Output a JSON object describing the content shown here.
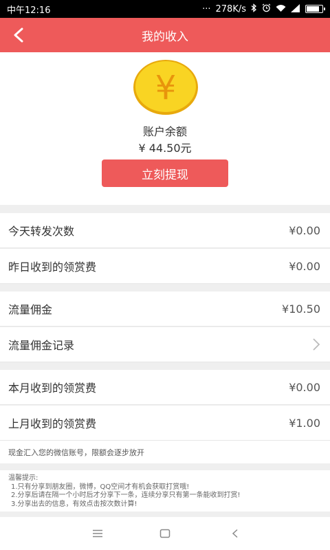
{
  "status_bar": {
    "time": "中午12:16",
    "dots": "···",
    "speed": "278K/s",
    "battery_level": 0.9
  },
  "header": {
    "title": "我的收入",
    "back_icon": "chevron-left-icon"
  },
  "balance": {
    "coin_symbol": "¥",
    "label": "账户余额",
    "amount": "¥ 44.50元",
    "withdraw_label": "立刻提现"
  },
  "rows": [
    {
      "label": "今天转发次数",
      "value": "¥0.00"
    },
    {
      "label": "昨日收到的领赏费",
      "value": "¥0.00"
    },
    {
      "label": "流量佣金",
      "value": "¥10.50"
    },
    {
      "label": "流量佣金记录",
      "value": ""
    },
    {
      "label": "本月收到的领赏费",
      "value": "¥0.00"
    },
    {
      "label": "上月收到的领赏费",
      "value": "¥1.00"
    }
  ],
  "notice": "现金汇入您的微信账号，限额会逐步放开",
  "tips": {
    "title": "温馨提示:",
    "items": [
      "1.只有分享到朋友圈，微博，QQ空间才有机会获取打赏哦!",
      "2.分享后请在隔一个小时后才分享下一条，连续分享只有第一条能收到打赏!",
      "3.分享出去的信息，有效点击按次数计算!"
    ]
  },
  "colors": {
    "accent": "#ee5a5a",
    "coin_fill": "#f9d423",
    "coin_edge": "#e8a90c"
  }
}
